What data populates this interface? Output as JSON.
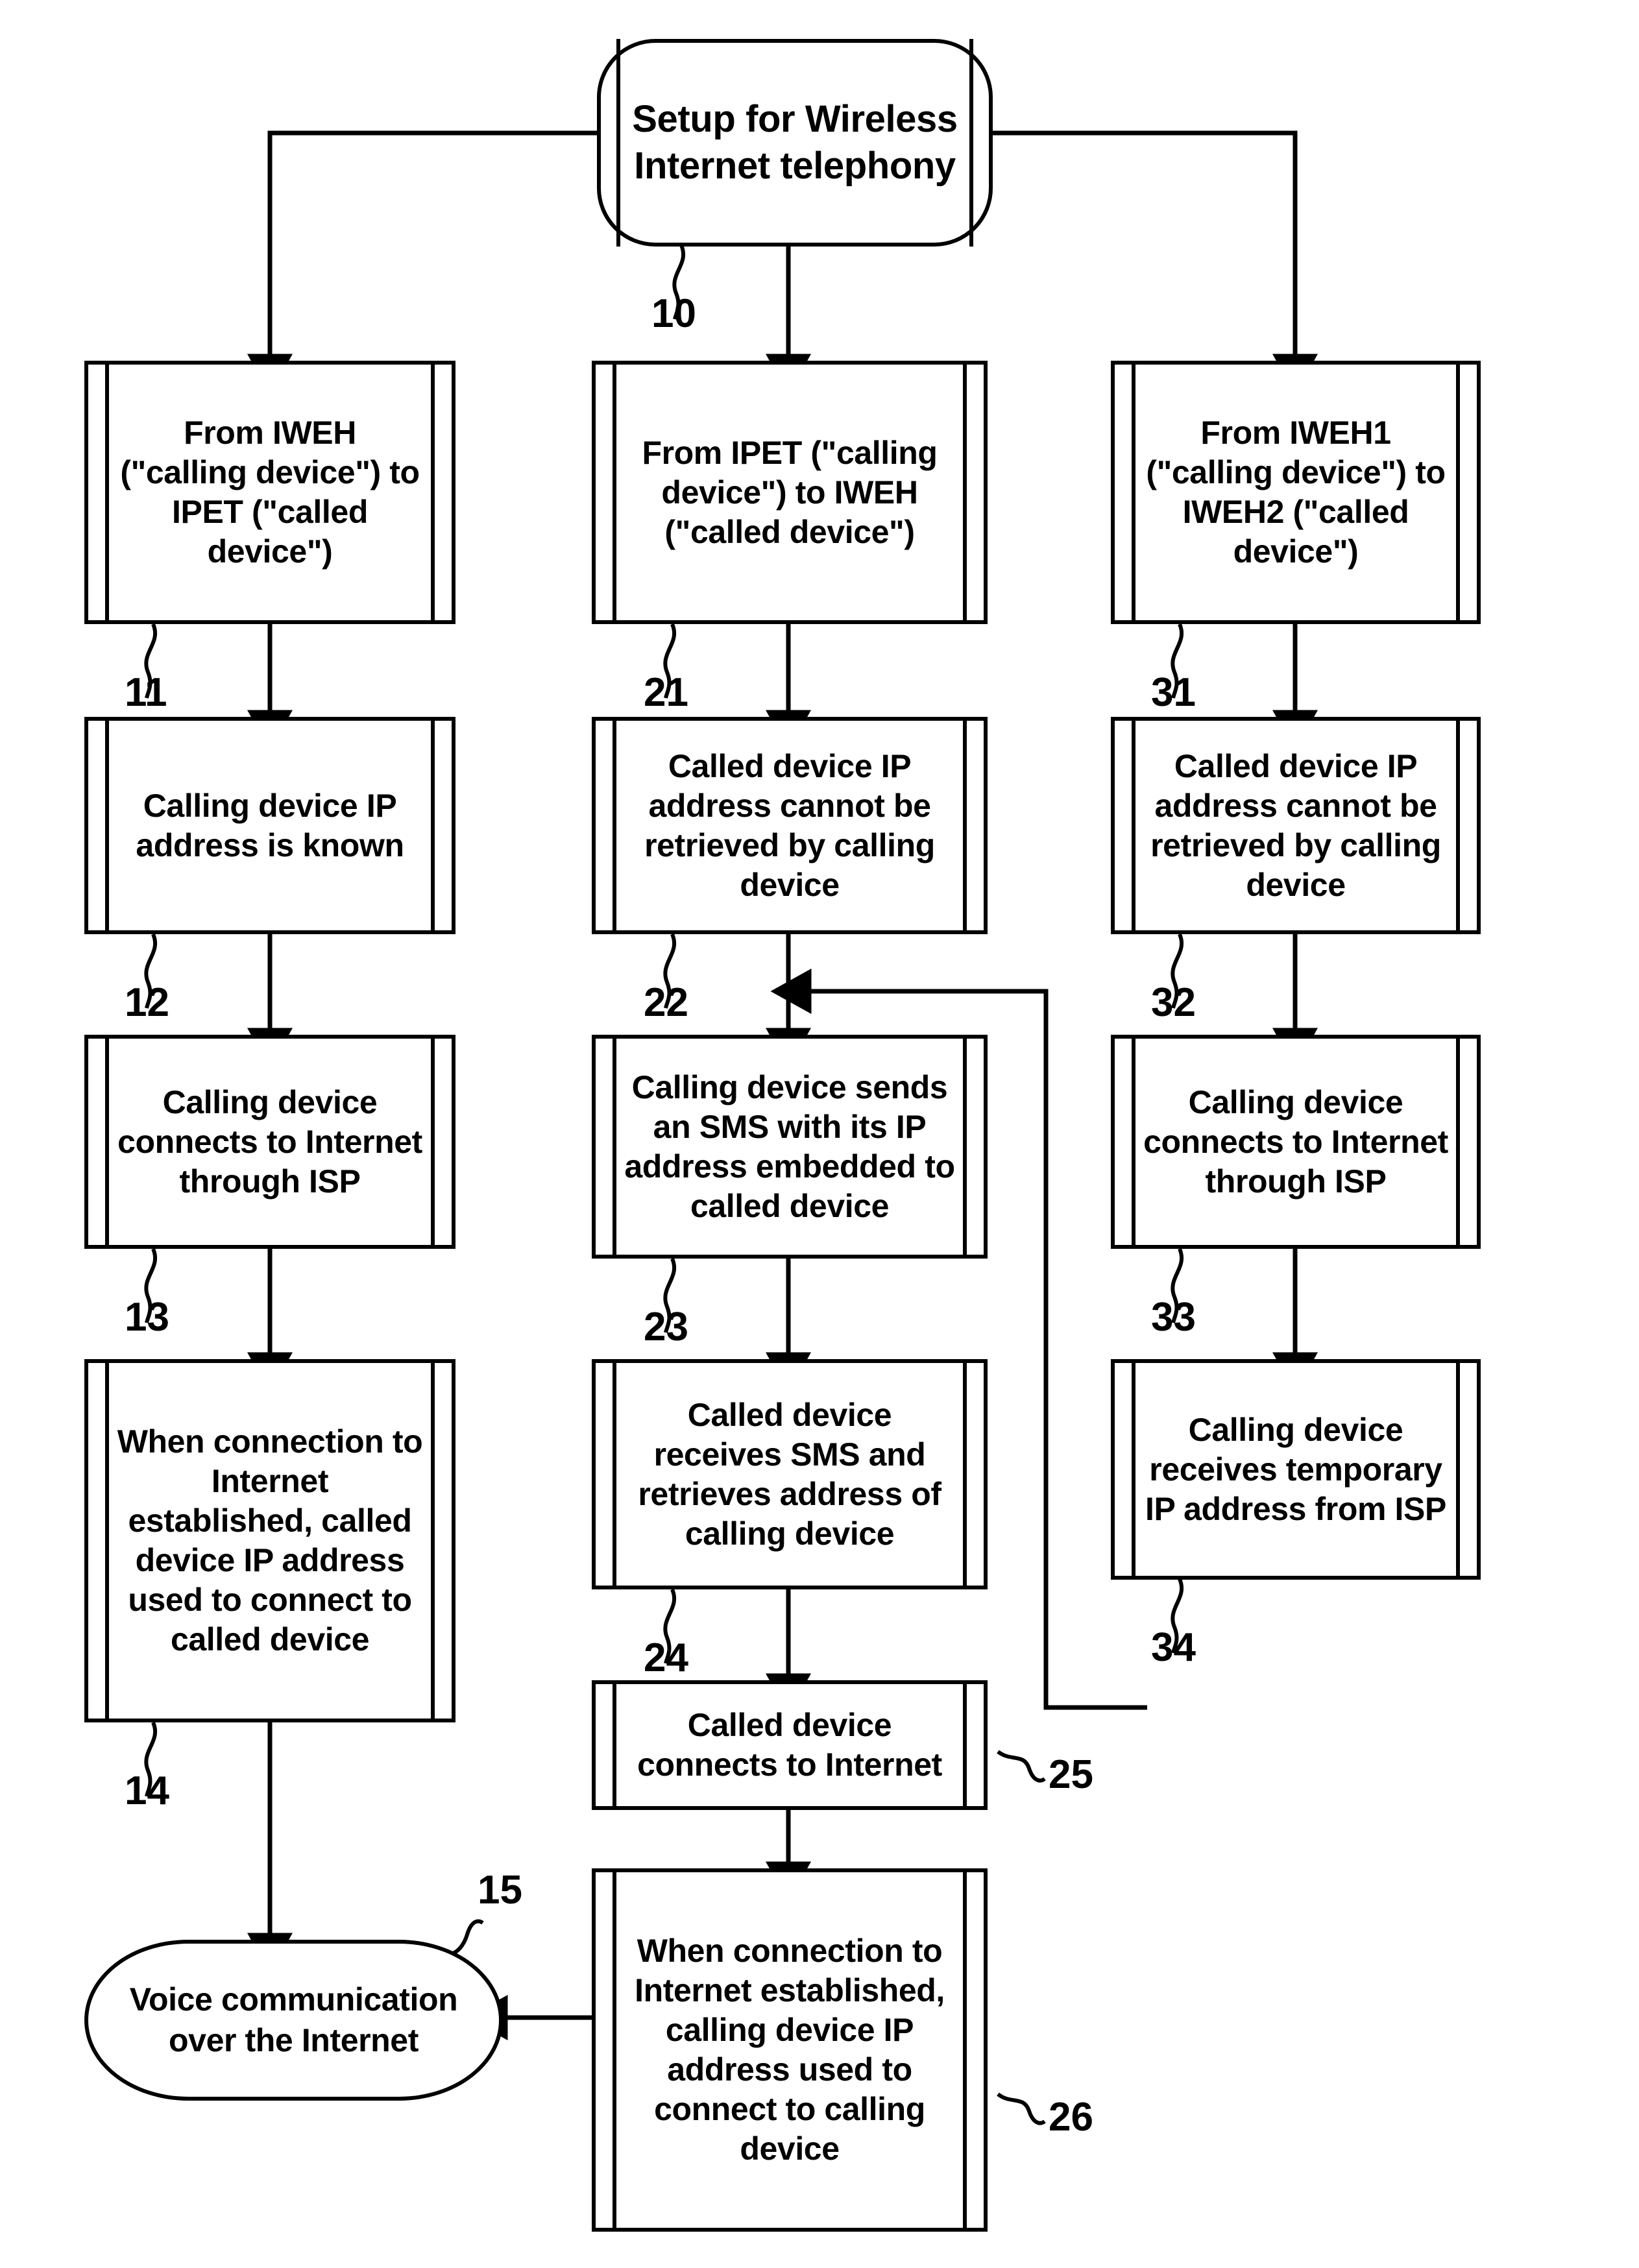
{
  "figure": {
    "type": "patent-flowchart",
    "title_node": {
      "id": "10",
      "label": "Setup for Wireless Internet telephony"
    },
    "columns": [
      {
        "name": "column-1-iweh-to-ipet",
        "steps": [
          {
            "ref": "11",
            "label": "From IWEH (\"calling device\") to IPET (\"called device\")"
          },
          {
            "ref": "12",
            "label": "Calling device IP address is known"
          },
          {
            "ref": "13",
            "label": "Calling device connects to Internet through ISP"
          },
          {
            "ref": "14",
            "label": "When connection to Internet established, called device IP address used to connect to called device"
          }
        ]
      },
      {
        "name": "column-2-ipet-to-iweh",
        "steps": [
          {
            "ref": "21",
            "label": "From IPET (\"calling device\") to IWEH (\"called device\")"
          },
          {
            "ref": "22",
            "label": "Called device IP address cannot be retrieved by calling device"
          },
          {
            "ref": "23",
            "label": "Calling device sends an SMS with its IP address embedded to called device"
          },
          {
            "ref": "24",
            "label": "Called device receives SMS and retrieves address of calling device"
          },
          {
            "ref": "25",
            "label": "Called device connects to Internet"
          },
          {
            "ref": "26",
            "label": "When connection to Internet established, calling device IP address used to connect to calling device"
          }
        ]
      },
      {
        "name": "column-3-iweh1-to-iweh2",
        "steps": [
          {
            "ref": "31",
            "label": "From IWEH1 (\"calling device\") to IWEH2 (\"called device\")"
          },
          {
            "ref": "32",
            "label": "Called device IP address cannot be retrieved by calling device"
          },
          {
            "ref": "33",
            "label": "Calling device connects to Internet through ISP"
          },
          {
            "ref": "34",
            "label": "Calling device receives temporary IP address from ISP"
          }
        ]
      }
    ],
    "end_node": {
      "id": "15",
      "label": "Voice communication over the Internet"
    },
    "ref_numbers": [
      "10",
      "11",
      "12",
      "13",
      "14",
      "15",
      "21",
      "22",
      "23",
      "24",
      "25",
      "26",
      "31",
      "32",
      "33",
      "34"
    ],
    "colors": {
      "line": "#000000",
      "background": "#ffffff",
      "text": "#000000"
    }
  }
}
